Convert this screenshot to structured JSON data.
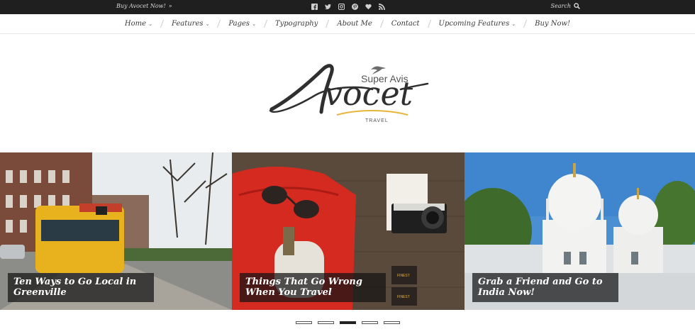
{
  "topbar": {
    "buy_label": "Buy Avocet Now!",
    "buy_chevron": "»",
    "socials": [
      "facebook-icon",
      "twitter-icon",
      "instagram-icon",
      "pinterest-icon",
      "heart-icon",
      "rss-icon"
    ],
    "search_label": "Search"
  },
  "nav": {
    "items": [
      {
        "label": "Home",
        "caret": "⌄"
      },
      {
        "label": "Features",
        "caret": "⌄"
      },
      {
        "label": "Pages",
        "caret": "⌄"
      },
      {
        "label": "Typography",
        "caret": ""
      },
      {
        "label": "About Me",
        "caret": ""
      },
      {
        "label": "Contact",
        "caret": ""
      },
      {
        "label": "Upcoming Features",
        "caret": "⌄"
      },
      {
        "label": "Buy Now!",
        "caret": ""
      }
    ]
  },
  "logo": {
    "wordmark": "Avocet",
    "tagline": "Super Avis",
    "sub": "TRAVEL"
  },
  "slides": [
    {
      "title": "Ten Ways to Go Local in Greenville"
    },
    {
      "title": "Things That Go Wrong When You Travel"
    },
    {
      "title": "Grab a Friend and Go to India Now!"
    }
  ],
  "pager": {
    "count": 5,
    "active": 3
  },
  "colors": {
    "topbar": "#1f1f1f",
    "accent": "#e7b43a",
    "caption_bg": "#141414"
  }
}
